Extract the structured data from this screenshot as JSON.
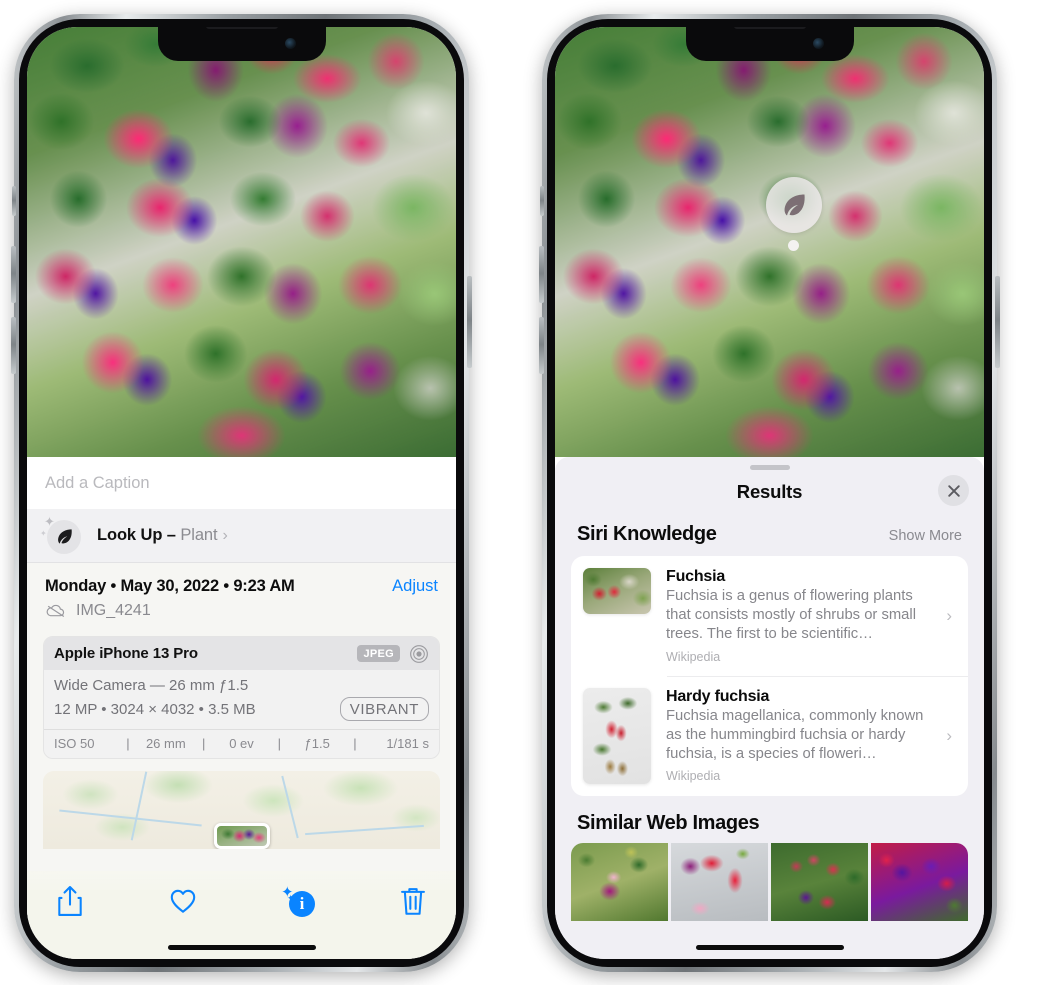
{
  "left_phone": {
    "caption_placeholder": "Add a Caption",
    "lookup": {
      "label": "Look Up –",
      "subject": "Plant",
      "chevron": "›",
      "icon": "leaf-icon"
    },
    "meta": {
      "date": "Monday • May 30, 2022 • 9:23 AM",
      "adjust_label": "Adjust",
      "filename": "IMG_4241",
      "cloud_icon": "icloud-slash-icon"
    },
    "camera": {
      "model": "Apple iPhone 13 Pro",
      "format_badge": "JPEG",
      "aperture_icon": "aperture-icon",
      "lens_line": "Wide Camera — 26 mm ƒ1.5",
      "specs_line": "12 MP • 3024 × 4032 • 3.5 MB",
      "style_badge": "VIBRANT",
      "exif": [
        "ISO 50",
        "26 mm",
        "0 ev",
        "ƒ1.5",
        "1/181 s"
      ]
    },
    "toolbar": [
      {
        "name": "share-button",
        "icon": "share-icon"
      },
      {
        "name": "favorite-button",
        "icon": "heart-icon"
      },
      {
        "name": "info-button",
        "icon": "info-sparkle-icon"
      },
      {
        "name": "delete-button",
        "icon": "trash-icon"
      }
    ]
  },
  "right_phone": {
    "badge_icon": "leaf-icon",
    "results": {
      "title": "Results",
      "close_icon": "close-icon"
    },
    "siri_knowledge": {
      "title": "Siri Knowledge",
      "action": "Show More",
      "items": [
        {
          "title": "Fuchsia",
          "description": "Fuchsia is a genus of flowering plants that consists mostly of shrubs or small trees. The first to be scientific…",
          "source": "Wikipedia",
          "chevron": "›"
        },
        {
          "title": "Hardy fuchsia",
          "description": "Fuchsia magellanica, commonly known as the hummingbird fuchsia or hardy fuchsia, is a species of floweri…",
          "source": "Wikipedia",
          "chevron": "›"
        }
      ]
    },
    "similar_web_images": {
      "title": "Similar Web Images",
      "thumbnails": [
        "fuchsia-thumb-1",
        "fuchsia-thumb-2",
        "fuchsia-thumb-3",
        "fuchsia-thumb-4"
      ]
    }
  },
  "colors": {
    "accent_blue": "#0a84ff",
    "sheet_bg": "#f0eff4",
    "card_bg": "#ffffff",
    "secondary_text": "#8a8a90"
  }
}
